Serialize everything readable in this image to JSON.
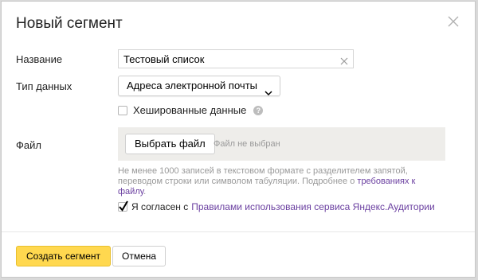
{
  "dialog": {
    "title": "Новый сегмент",
    "close_icon": "close-icon"
  },
  "form": {
    "name_label": "Название",
    "name_value": "Тестовый список",
    "data_type_label": "Тип данных",
    "data_type_selected": "Адреса электронной почты",
    "hashed_label": "Хешированные данные",
    "hashed_checked": false,
    "help_icon": "?",
    "file_label": "Файл",
    "file_button": "Выбрать файл",
    "file_status": "Файл не выбран",
    "hint_text": "Не менее 1000 записей в текстовом формате с разделителем запятой, переводом строки или символом табуляции. Подробнее о",
    "hint_link": "требованиях к файлу",
    "hint_end": ".",
    "agree_prefix": "Я согласен с",
    "agree_link": "Правилами использования сервиса Яндекс.Аудитории",
    "agree_checked": true
  },
  "footer": {
    "create_button": "Создать сегмент",
    "cancel_button": "Отмена"
  },
  "colors": {
    "primary_button": "#ffd84f",
    "link": "#6a3fa0",
    "file_area_bg": "#eeedea",
    "checkmark": "#000000"
  }
}
